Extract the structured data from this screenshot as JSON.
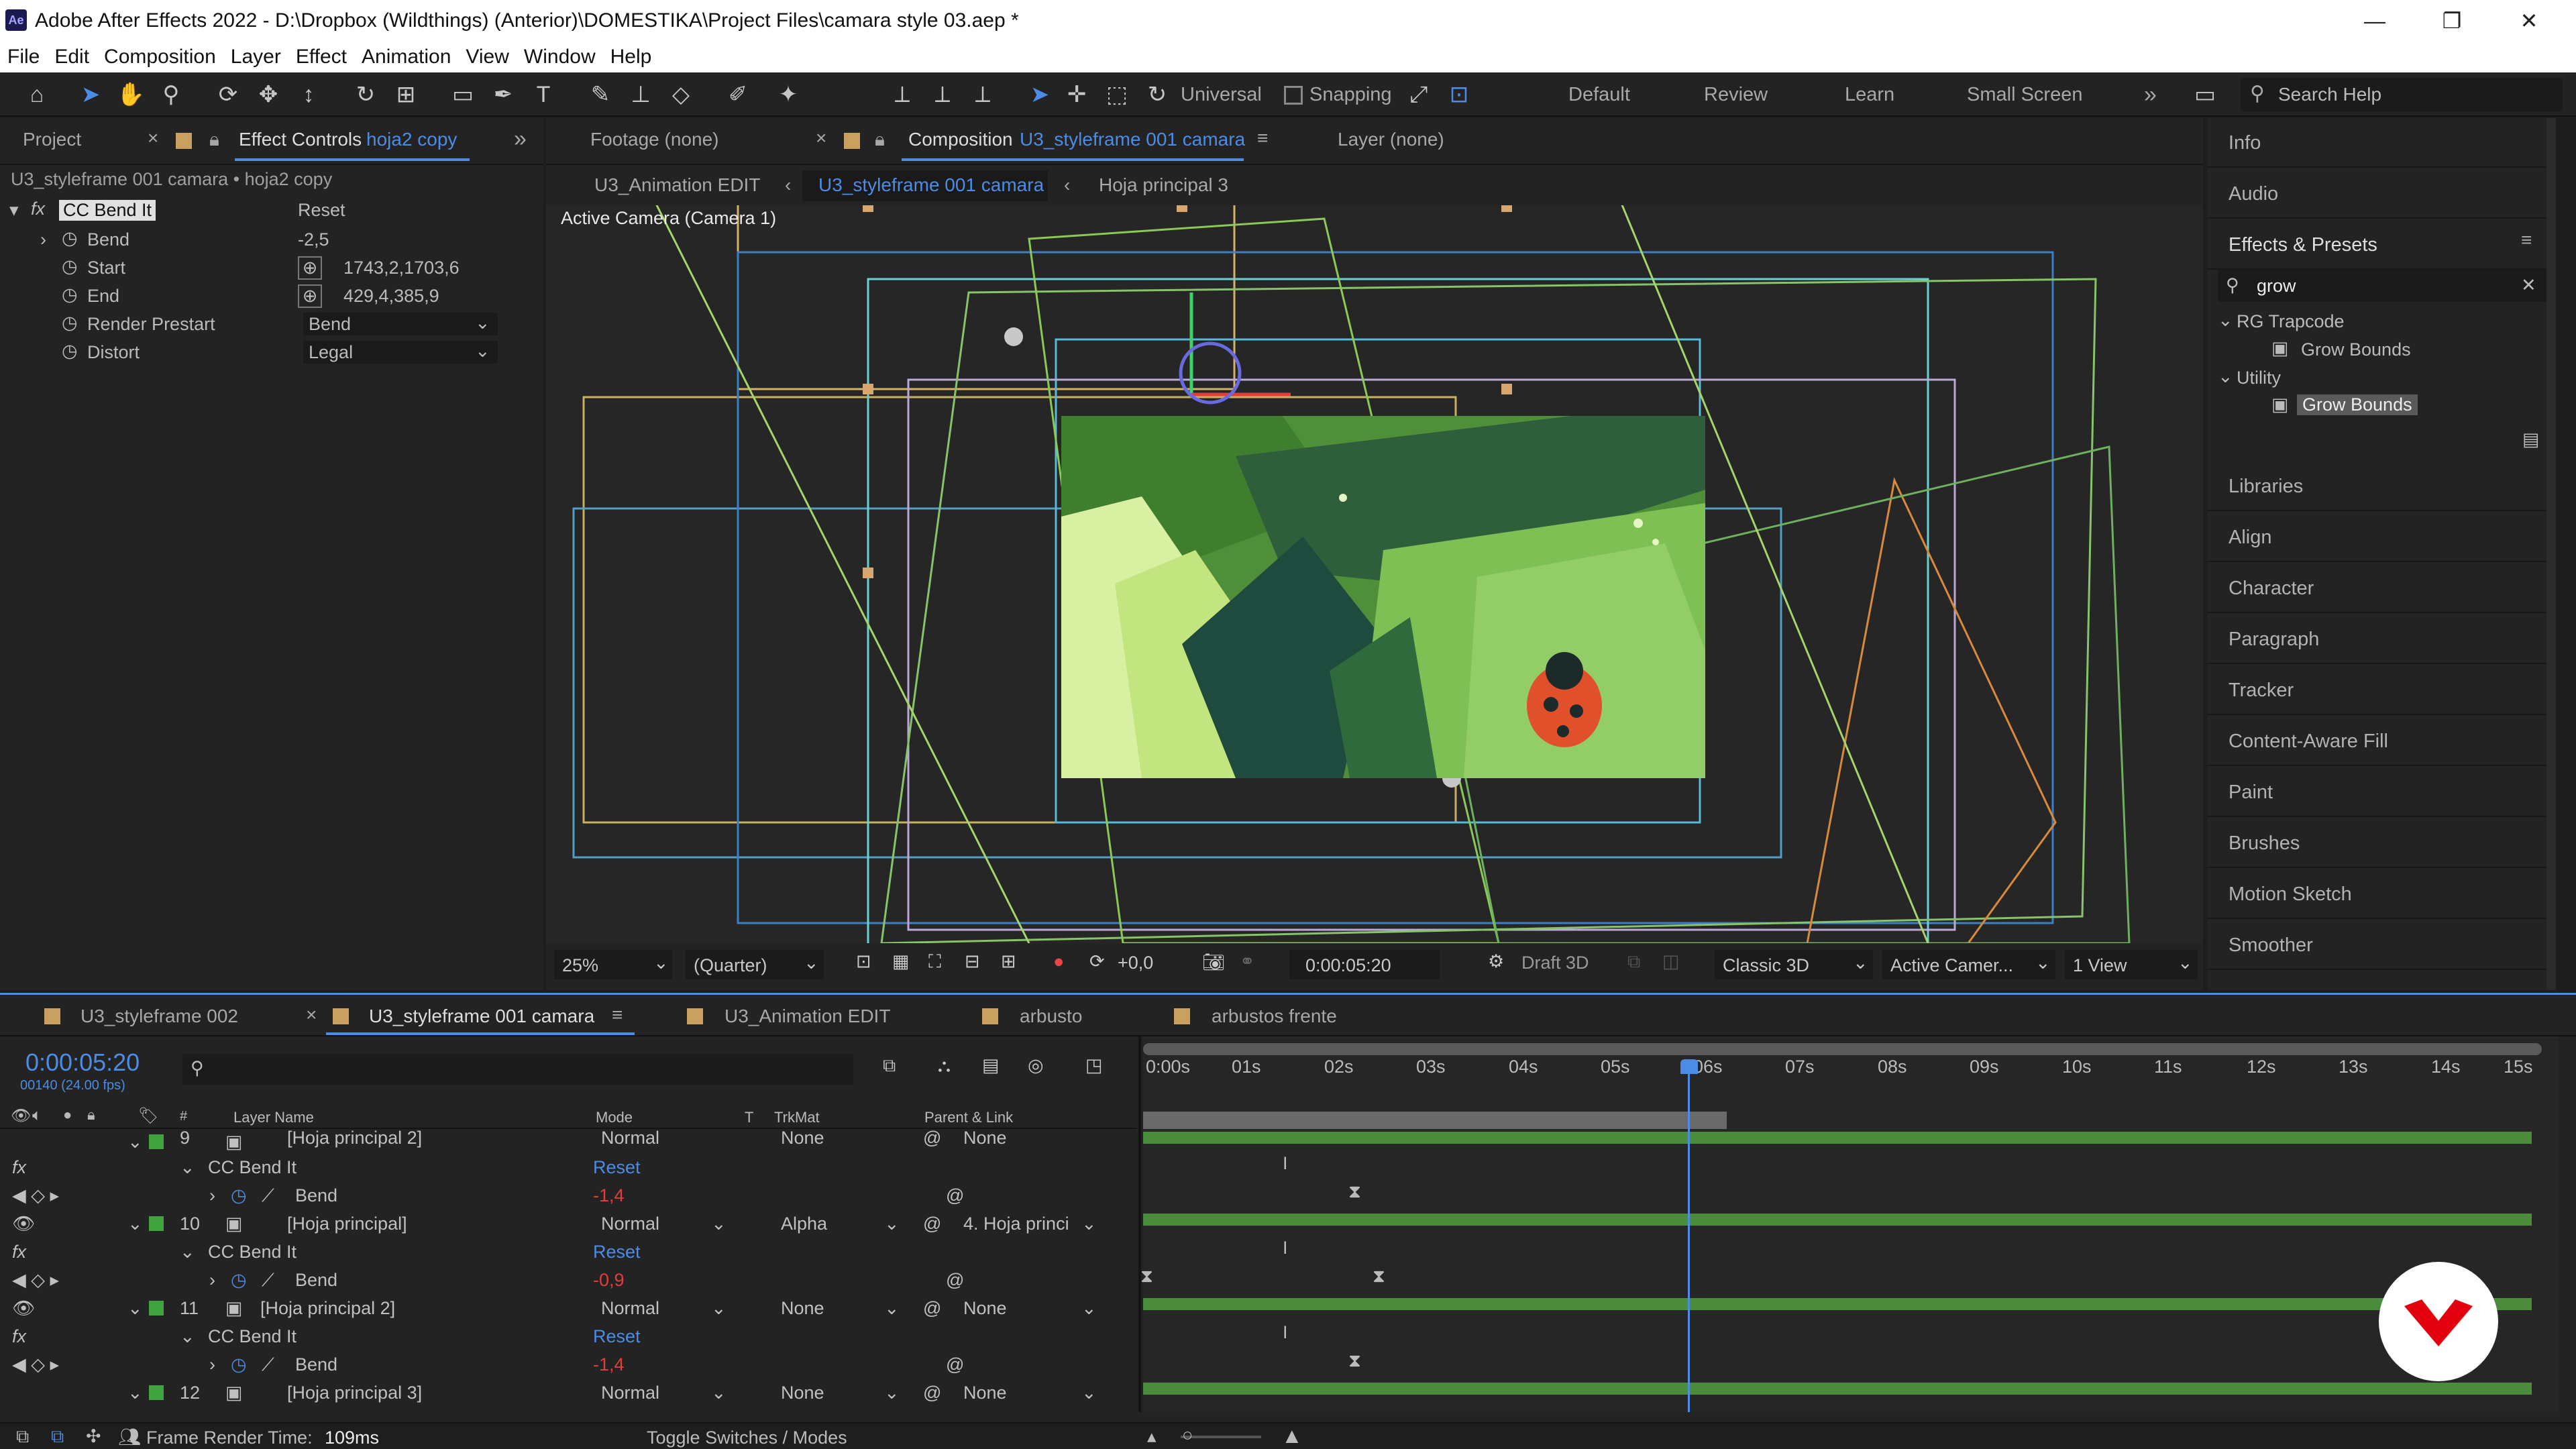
{
  "window": {
    "title": "Adobe After Effects 2022 - D:\\Dropbox (Wildthings) (Anterior)\\DOMESTIKA\\Project Files\\camara style 03.aep *",
    "logo": "Ae",
    "minimize": "—",
    "restore": "❐",
    "close": "✕"
  },
  "menu": [
    "File",
    "Edit",
    "Composition",
    "Layer",
    "Effect",
    "Animation",
    "View",
    "Window",
    "Help"
  ],
  "toolbar": {
    "universal": "Universal",
    "snapping": "Snapping",
    "workspaces": [
      "Default",
      "Review",
      "Learn",
      "Small Screen"
    ],
    "more": "»",
    "search_placeholder": "Search Help"
  },
  "left_panel": {
    "tab_project": "Project",
    "tab_effect_controls": "Effect Controls",
    "effect_layer": "hoja2 copy",
    "source_line": "U3_styleframe 001 camara • hoja2 copy",
    "effect_name": "CC Bend It",
    "reset": "Reset",
    "props": [
      {
        "name": "Bend",
        "value": "-2,5"
      },
      {
        "name": "Start",
        "value": "1743,2,1703,6"
      },
      {
        "name": "End",
        "value": "429,4,385,9"
      },
      {
        "name": "Render Prestart",
        "value": "Bend"
      },
      {
        "name": "Distort",
        "value": "Legal"
      }
    ]
  },
  "viewer": {
    "tab_footage": "Footage (none)",
    "tab_composition": "Composition",
    "comp_name": "U3_styleframe 001 camara",
    "tab_layer": "Layer (none)",
    "crumbs": [
      "U3_Animation EDIT",
      "U3_styleframe 001 camara",
      "Hoja principal 3"
    ],
    "active_camera": "Active Camera (Camera 1)",
    "zoom": "25%",
    "resolution": "(Quarter)",
    "exposure": "+0,0",
    "timecode": "0:00:05:20",
    "draft3d": "Draft 3D",
    "renderer": "Classic 3D",
    "camera": "Active Camer...",
    "views": "1 View"
  },
  "right_panel": {
    "items_top": [
      "Info",
      "Audio"
    ],
    "effects_presets": "Effects & Presets",
    "search_value": "grow",
    "tree": [
      {
        "folder": "RG Trapcode",
        "child": "Grow Bounds"
      },
      {
        "folder": "Utility",
        "child": "Grow Bounds"
      }
    ],
    "items": [
      "Libraries",
      "Align",
      "Character",
      "Paragraph",
      "Tracker",
      "Content-Aware Fill",
      "Paint",
      "Brushes",
      "Motion Sketch",
      "Smoother"
    ]
  },
  "timeline": {
    "tabs": [
      "U3_styleframe 002",
      "U3_styleframe 001 camara",
      "U3_Animation EDIT",
      "arbusto",
      "arbustos frente"
    ],
    "timecode": "0:00:05:20",
    "fps": "00140 (24.00 fps)",
    "columns": {
      "layer_name": "Layer Name",
      "mode": "Mode",
      "t": "T",
      "trkmat": "TrkMat",
      "parent": "Parent & Link"
    },
    "ruler": [
      "0:00s",
      "01s",
      "02s",
      "03s",
      "04s",
      "05s",
      "06s",
      "07s",
      "08s",
      "09s",
      "10s",
      "11s",
      "12s",
      "13s",
      "14s",
      "15s"
    ],
    "rows": [
      {
        "kind": "layer",
        "num": "9",
        "name": "[Hoja principal 2]",
        "mode": "Normal",
        "trkmat": "None",
        "parent": "None"
      },
      {
        "kind": "effect",
        "name": "CC Bend It",
        "reset": "Reset"
      },
      {
        "kind": "prop",
        "name": "Bend",
        "value": "-1,4"
      },
      {
        "kind": "layer",
        "num": "10",
        "name": "[Hoja principal]",
        "mode": "Normal",
        "trkmat": "Alpha",
        "parent": "4. Hoja princi"
      },
      {
        "kind": "effect",
        "name": "CC Bend It",
        "reset": "Reset"
      },
      {
        "kind": "prop",
        "name": "Bend",
        "value": "-0,9"
      },
      {
        "kind": "layer",
        "num": "11",
        "name": "[Hoja principal 2]",
        "mode": "Normal",
        "trkmat": "None",
        "parent": "None"
      },
      {
        "kind": "effect",
        "name": "CC Bend It",
        "reset": "Reset"
      },
      {
        "kind": "prop",
        "name": "Bend",
        "value": "-1,4"
      },
      {
        "kind": "layer",
        "num": "12",
        "name": "[Hoja principal 3]",
        "mode": "Normal",
        "trkmat": "None",
        "parent": "None"
      }
    ]
  },
  "status": {
    "frame_render_label": "Frame Render Time:",
    "frame_render_value": "109ms",
    "toggle": "Toggle Switches / Modes"
  },
  "colors": {
    "accent_blue": "#4c8ce6",
    "label_green": "#3fa33f",
    "value_red": "#e33c3c",
    "brand_red": "#e3000f"
  }
}
